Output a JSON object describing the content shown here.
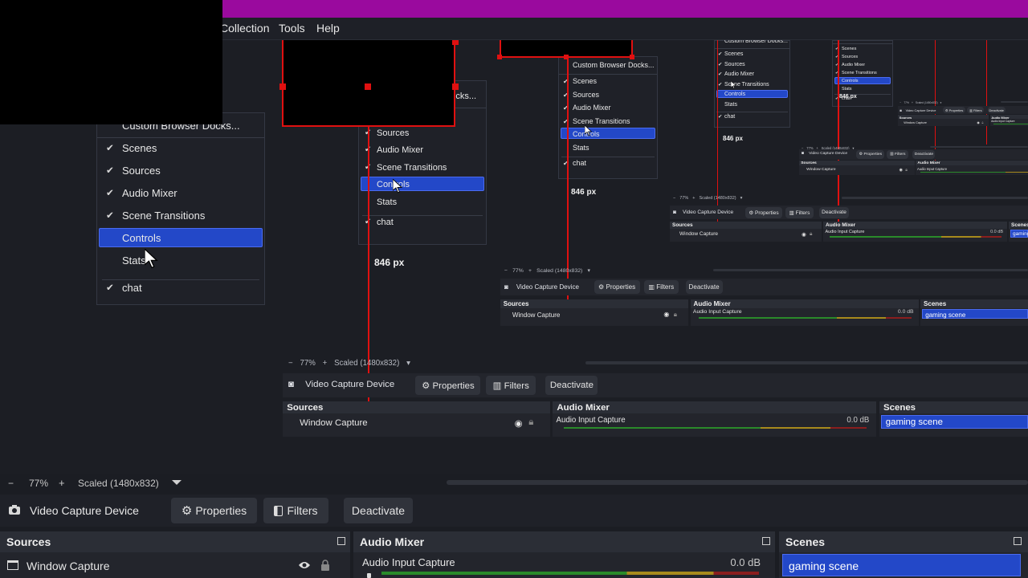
{
  "menubar": {
    "items": [
      "Collection",
      "Tools",
      "Help"
    ]
  },
  "docks_menu": {
    "custom_label": "Custom Browser Docks...",
    "items": [
      {
        "label": "Scenes",
        "checked": true
      },
      {
        "label": "Sources",
        "checked": true
      },
      {
        "label": "Audio Mixer",
        "checked": true
      },
      {
        "label": "Scene Transitions",
        "checked": true
      },
      {
        "label": "Controls",
        "checked": false
      },
      {
        "label": "Stats",
        "checked": false
      },
      {
        "label": "chat",
        "checked": true
      }
    ]
  },
  "px_label": "846 px",
  "zoom": {
    "minus": "−",
    "value": "77%",
    "plus": "+",
    "scaled": "Scaled (1480x832)"
  },
  "controls": {
    "source_name": "Video Capture Device",
    "properties": "Properties",
    "filters": "Filters",
    "deactivate": "Deactivate"
  },
  "sources": {
    "title": "Sources",
    "item": "Window Capture"
  },
  "audio_mixer": {
    "title": "Audio Mixer",
    "input": "Audio Input Capture",
    "level": "0.0 dB"
  },
  "scenes": {
    "title": "Scenes",
    "item": "gaming scene"
  },
  "colors": {
    "accent": "#2348c8",
    "topbar": "#9a0a9e",
    "guide": "#e01010"
  }
}
